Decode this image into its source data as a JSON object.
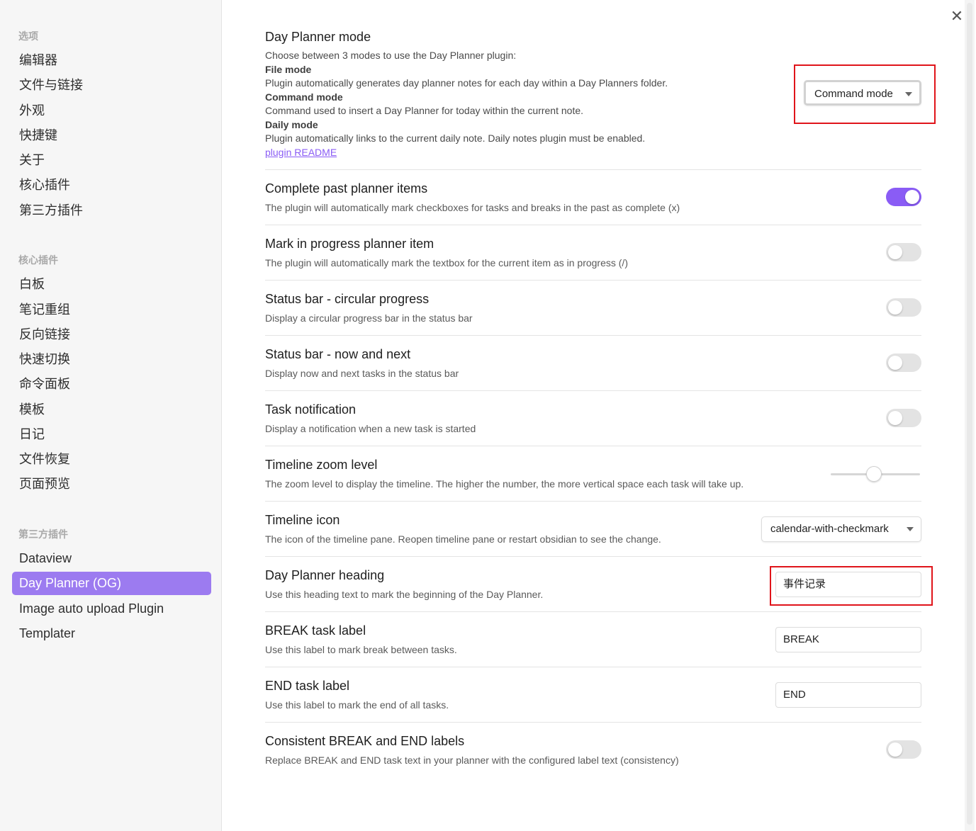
{
  "sidebar": {
    "groups": [
      {
        "title": "选项",
        "items": [
          "编辑器",
          "文件与链接",
          "外观",
          "快捷键",
          "关于",
          "核心插件",
          "第三方插件"
        ]
      },
      {
        "title": "核心插件",
        "items": [
          "白板",
          "笔记重组",
          "反向链接",
          "快速切换",
          "命令面板",
          "模板",
          "日记",
          "文件恢复",
          "页面预览"
        ]
      },
      {
        "title": "第三方插件",
        "items": [
          "Dataview",
          "Day Planner (OG)",
          "Image auto upload Plugin",
          "Templater"
        ]
      }
    ],
    "active_item": "Day Planner (OG)"
  },
  "close_glyph": "✕",
  "settings": {
    "mode": {
      "name": "Day Planner mode",
      "intro": "Choose between 3 modes to use the Day Planner plugin:",
      "file_title": "File mode",
      "file_desc": "Plugin automatically generates day planner notes for each day within a Day Planners folder.",
      "command_title": "Command mode",
      "command_desc": "Command used to insert a Day Planner for today within the current note.",
      "daily_title": "Daily mode",
      "daily_desc": "Plugin automatically links to the current daily note. Daily notes plugin must be enabled.",
      "link": "plugin README",
      "value": "Command mode"
    },
    "complete_past": {
      "name": "Complete past planner items",
      "desc": "The plugin will automatically mark checkboxes for tasks and breaks in the past as complete (x)",
      "enabled": true
    },
    "mark_progress": {
      "name": "Mark in progress planner item",
      "desc": "The plugin will automatically mark the textbox for the current item as in progress (/)",
      "enabled": false
    },
    "circular": {
      "name": "Status bar - circular progress",
      "desc": "Display a circular progress bar in the status bar",
      "enabled": false
    },
    "now_next": {
      "name": "Status bar - now and next",
      "desc": "Display now and next tasks in the status bar",
      "enabled": false
    },
    "notification": {
      "name": "Task notification",
      "desc": "Display a notification when a new task is started",
      "enabled": false
    },
    "zoom": {
      "name": "Timeline zoom level",
      "desc": "The zoom level to display the timeline. The higher the number, the more vertical space each task will take up."
    },
    "icon": {
      "name": "Timeline icon",
      "desc": "The icon of the timeline pane. Reopen timeline pane or restart obsidian to see the change.",
      "value": "calendar-with-checkmark"
    },
    "heading": {
      "name": "Day Planner heading",
      "desc": "Use this heading text to mark the beginning of the Day Planner.",
      "value": "事件记录"
    },
    "break_label": {
      "name": "BREAK task label",
      "desc": "Use this label to mark break between tasks.",
      "value": "BREAK"
    },
    "end_label": {
      "name": "END task label",
      "desc": "Use this label to mark the end of all tasks.",
      "value": "END"
    },
    "consistent": {
      "name": "Consistent BREAK and END labels",
      "desc": "Replace BREAK and END task text in your planner with the configured label text (consistency)",
      "enabled": false
    }
  },
  "colors": {
    "accent": "#8a5cf5",
    "sidebar_active": "#9c7bf0",
    "highlight": "#e0141a"
  }
}
